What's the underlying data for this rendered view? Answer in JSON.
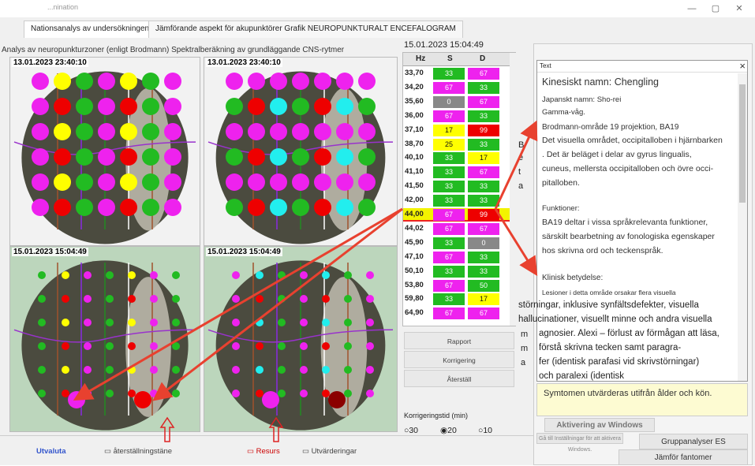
{
  "window": {
    "title": "...nination"
  },
  "tabs": [
    {
      "label": "Nationsanalys av undersökningen"
    },
    {
      "label": "Jämförande aspekt för akupunktörer Grafik NEUROPUNKTURALT ENCEFALOGRAM"
    }
  ],
  "subtitle": "Analys av neuropunkturzoner (enligt Brodmann) Spektralberäkning av grundläggande CNS-rytmer",
  "panels": [
    {
      "timestamp": "13.01.2023 23:40:10"
    },
    {
      "timestamp": "13.01.2023 23:40:10"
    },
    {
      "timestamp": "15.01.2023 15:04:49"
    },
    {
      "timestamp": "15.01.2023 15:04:49"
    }
  ],
  "table": {
    "date": "15.01.2023 15:04:49",
    "headers": {
      "hz": "Hz",
      "s": "S",
      "d": "D"
    },
    "rows": [
      {
        "hz": "33,70",
        "s": "33",
        "sc": "#22bb22",
        "d": "67",
        "dc": "#ee22ee"
      },
      {
        "hz": "34,20",
        "s": "67",
        "sc": "#ee22ee",
        "d": "33",
        "dc": "#22bb22"
      },
      {
        "hz": "35,60",
        "s": "0",
        "sc": "#888888",
        "d": "67",
        "dc": "#ee22ee"
      },
      {
        "hz": "36,00",
        "s": "67",
        "sc": "#ee22ee",
        "d": "33",
        "dc": "#22bb22"
      },
      {
        "hz": "37,10",
        "s": "17",
        "sc": "#ffff00",
        "d": "99",
        "dc": "#ee0000"
      },
      {
        "hz": "38,70",
        "s": "25",
        "sc": "#ffff00",
        "d": "33",
        "dc": "#22bb22"
      },
      {
        "hz": "40,10",
        "s": "33",
        "sc": "#22bb22",
        "d": "17",
        "dc": "#ffff00"
      },
      {
        "hz": "41,10",
        "s": "33",
        "sc": "#22bb22",
        "d": "67",
        "dc": "#ee22ee"
      },
      {
        "hz": "41,50",
        "s": "33",
        "sc": "#22bb22",
        "d": "33",
        "dc": "#22bb22"
      },
      {
        "hz": "42,00",
        "s": "33",
        "sc": "#22bb22",
        "d": "33",
        "dc": "#22bb22"
      },
      {
        "hz": "44,00",
        "s": "67",
        "sc": "#ee22ee",
        "d": "99",
        "dc": "#ee0000"
      },
      {
        "hz": "44,02",
        "s": "67",
        "sc": "#ee22ee",
        "d": "67",
        "dc": "#ee22ee"
      },
      {
        "hz": "45,90",
        "s": "33",
        "sc": "#22bb22",
        "d": "0",
        "dc": "#888888"
      },
      {
        "hz": "47,10",
        "s": "67",
        "sc": "#ee22ee",
        "d": "33",
        "dc": "#22bb22"
      },
      {
        "hz": "50,10",
        "s": "33",
        "sc": "#22bb22",
        "d": "33",
        "dc": "#22bb22"
      },
      {
        "hz": "53,80",
        "s": "67",
        "sc": "#ee22ee",
        "d": "50",
        "dc": "#22bb22"
      },
      {
        "hz": "59,80",
        "s": "33",
        "sc": "#22bb22",
        "d": "17",
        "dc": "#ffff00"
      },
      {
        "hz": "64,90",
        "s": "67",
        "sc": "#ee22ee",
        "d": "67",
        "dc": "#ee22ee"
      }
    ]
  },
  "buttons": {
    "rapport": "Rapport",
    "korrigering": "Korrigering",
    "aterstall": "Återställ"
  },
  "korrigeringstid": {
    "label": "Korrigeringstid (min)",
    "options": [
      "30",
      "20",
      "10"
    ],
    "selected": "20"
  },
  "side_letters": {
    "b": "B",
    "e": "e",
    "t": "t",
    "a": "a",
    "m1": "m",
    "m2": "m",
    "a2": "a"
  },
  "popup": {
    "header": "Text",
    "close": "×",
    "title": "Kinesiskt namn: Chengling",
    "japanese": "Japanskt namn: Sho-rei",
    "wave": "Gamma-våg.",
    "brodmann": "Brodmann-område 19 projektion, BA19",
    "desc1": "Det visuella området, occipitalloben i hjärnbarken",
    "desc2": ". Det är beläget i delar av gyrus lingualis,",
    "desc3": "cuneus, mellersta occipitalloben och övre occi-",
    "desc4": "pitalloben.",
    "functions_label": "Funktioner:",
    "func1": "BA19 deltar i vissa språkrelevanta funktioner,",
    "func2": "särskilt bearbetning av fonologiska egenskaper",
    "func3": "hos skrivna ord och teckenspråk.",
    "clinical_label": "Klinisk betydelse:",
    "clin1": "Lesioner i detta område orsakar flera visuella",
    "clin2": "störningar, inklusive synfältsdefekter, visuella",
    "clin3": "hallucinationer, visuellt minne och andra visuella",
    "clin4": "agnosier. Alexi – förlust av förmågan att läsa,",
    "clin5": "förstå skrivna tecken samt paragra-",
    "clin6": "fer (identisk parafasi vid skrivstörningar)",
    "clin7": "och paralexi (identisk"
  },
  "yellow_note": "Symtomen utvärderas utifrån ålder och kön.",
  "right_buttons": {
    "activate": "Aktivering av Windows",
    "activate_sub": "Gå till Inställningar för att aktivera Windows.",
    "gruppanalyser": "Gruppanalyser ES",
    "jamfor": "Jämför fantomer"
  },
  "bottom": {
    "utvardering": "Utvärderingar",
    "resurs": "Resurs",
    "aterstallning": "återställningstäne",
    "utvaluta": "Utvaluta"
  },
  "colors": {
    "magenta": "#ee22ee",
    "green": "#22bb22",
    "yellow": "#ffff00",
    "red": "#ee0000",
    "cyan": "#22eeee",
    "arrow": "#e8412f"
  }
}
